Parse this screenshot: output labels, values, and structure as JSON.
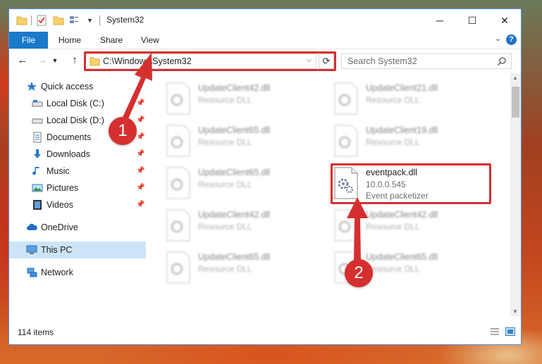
{
  "window": {
    "title": "System32",
    "minimize": "─",
    "maximize": "☐",
    "close": "✕"
  },
  "ribbon": {
    "tabs": [
      "File",
      "Home",
      "Share",
      "View"
    ],
    "help": "?"
  },
  "navbar": {
    "address": "C:\\Windows\\System32",
    "search_placeholder": "Search System32"
  },
  "sidebar": {
    "items": [
      {
        "label": "Quick access",
        "icon": "star-icon"
      },
      {
        "label": "Local Disk (C:)",
        "icon": "drive-icon"
      },
      {
        "label": "Local Disk (D:)",
        "icon": "drive-icon"
      },
      {
        "label": "Documents",
        "icon": "documents-icon"
      },
      {
        "label": "Downloads",
        "icon": "download-icon"
      },
      {
        "label": "Music",
        "icon": "music-icon"
      },
      {
        "label": "Pictures",
        "icon": "pictures-icon"
      },
      {
        "label": "Videos",
        "icon": "videos-icon"
      },
      {
        "label": "OneDrive",
        "icon": "cloud-icon"
      },
      {
        "label": "This PC",
        "icon": "computer-icon"
      },
      {
        "label": "Network",
        "icon": "network-icon"
      }
    ]
  },
  "files": [
    {
      "name": "UpdateClient42.dll",
      "sub": "Resource DLL"
    },
    {
      "name": "UpdateClient21.dll",
      "sub": "Resource DLL"
    },
    {
      "name": "UpdateClient65.dll",
      "sub": "Resource DLL"
    },
    {
      "name": "UpdateClient19.dll",
      "sub": "Resource DLL"
    },
    {
      "name": "UpdateClient65.dll",
      "sub": "Resource DLL"
    },
    {
      "name": "eventpack.dll",
      "version": "10.0.0.545",
      "description": "Event packetizer"
    },
    {
      "name": "UpdateClient42.dll",
      "sub": "Resource DLL"
    },
    {
      "name": "UpdateClient42.dll",
      "sub": "Resource DLL"
    },
    {
      "name": "UpdateClient65.dll",
      "sub": "Resource DLL"
    },
    {
      "name": "UpdateClient65.dll",
      "sub": "Resource DLL"
    }
  ],
  "status": {
    "item_count": "114 items"
  },
  "annotations": {
    "badge1": "1",
    "badge2": "2",
    "color": "#d62f2f"
  }
}
